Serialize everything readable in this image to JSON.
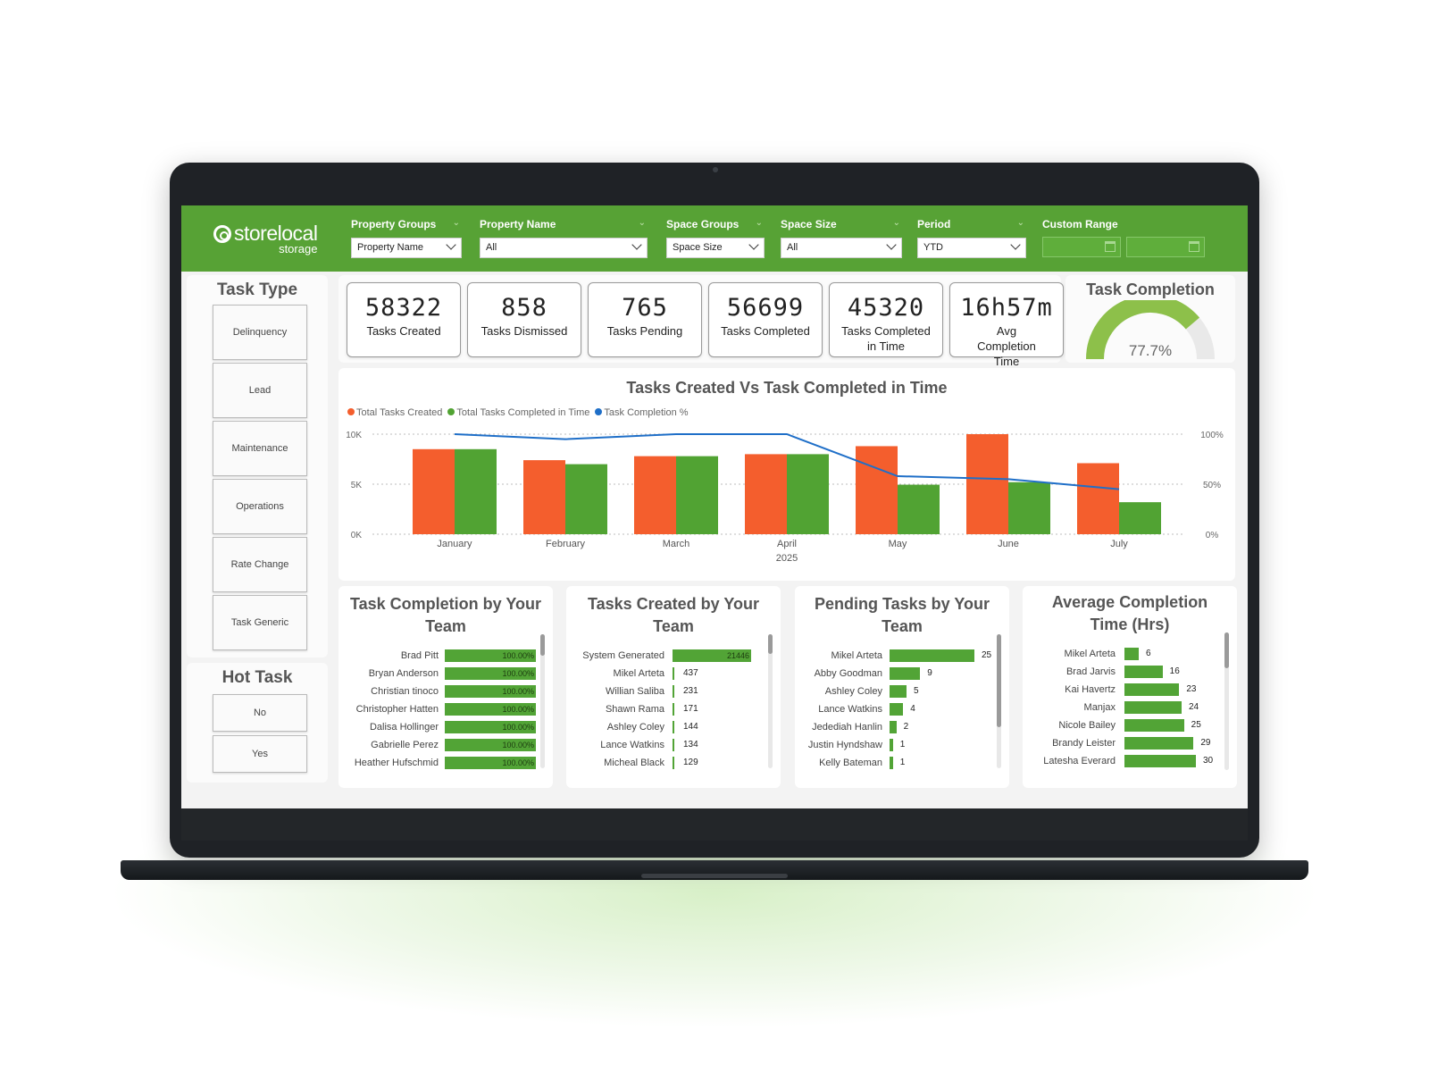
{
  "header": {
    "logo_main": "storelocal",
    "logo_sub": "storage",
    "filters": [
      {
        "label": "Property Groups",
        "value": "Property Name"
      },
      {
        "label": "Property Name",
        "value": "All"
      },
      {
        "label": "Space Groups",
        "value": "Space Size"
      },
      {
        "label": "Space Size",
        "value": "All"
      },
      {
        "label": "Period",
        "value": "YTD"
      }
    ],
    "custom_range_label": "Custom Range"
  },
  "task_type": {
    "title": "Task Type",
    "items": [
      "Delinquency",
      "Lead",
      "Maintenance",
      "Operations",
      "Rate Change",
      "Task Generic"
    ]
  },
  "hot_task": {
    "title": "Hot Task",
    "items": [
      "No",
      "Yes"
    ]
  },
  "kpis": [
    {
      "value": "58322",
      "label": "Tasks Created"
    },
    {
      "value": "858",
      "label": "Tasks Dismissed"
    },
    {
      "value": "765",
      "label": "Tasks Pending"
    },
    {
      "value": "56699",
      "label": "Tasks Completed"
    },
    {
      "value": "45320",
      "label": "Tasks Completed in Time"
    },
    {
      "value": "16h57m",
      "label": "Avg Completion Time"
    }
  ],
  "gauge": {
    "title": "Task Completion",
    "value_label": "77.7%",
    "value": 0.777,
    "color": "#8dc04a"
  },
  "chart_data": {
    "type": "bar",
    "title": "Tasks Created Vs Task Completed in Time",
    "categories": [
      "January",
      "February",
      "March",
      "April",
      "May",
      "June",
      "July"
    ],
    "x_sublabel": "2025",
    "y_ticks": [
      "10K",
      "5K",
      "0K"
    ],
    "y2_ticks": [
      "100%",
      "50%",
      "0%"
    ],
    "ylim": [
      0,
      10000
    ],
    "y2lim": [
      0,
      100
    ],
    "series": [
      {
        "name": "Total Tasks Created",
        "color": "#f45e2d",
        "values": [
          8500,
          7400,
          7800,
          8000,
          8800,
          10000,
          7100
        ]
      },
      {
        "name": "Total Tasks Completed in Time",
        "color": "#51a333",
        "values": [
          8500,
          7000,
          7800,
          8000,
          4950,
          5200,
          3200
        ]
      },
      {
        "name": "Task Completion %",
        "color": "#1f6fc8",
        "type": "line",
        "values": [
          100,
          95,
          100,
          100,
          58,
          55,
          45
        ]
      }
    ]
  },
  "team_completion": {
    "title": "Task Completion by Your Team",
    "rows": [
      {
        "name": "Brad Pitt",
        "value": 100,
        "label": "100.00%"
      },
      {
        "name": "Bryan Anderson",
        "value": 100,
        "label": "100.00%"
      },
      {
        "name": "Christian tinoco",
        "value": 100,
        "label": "100.00%"
      },
      {
        "name": "Christopher Hatten",
        "value": 100,
        "label": "100.00%"
      },
      {
        "name": "Dalisa Hollinger",
        "value": 100,
        "label": "100.00%"
      },
      {
        "name": "Gabrielle Perez",
        "value": 100,
        "label": "100.00%"
      },
      {
        "name": "Heather Hufschmid",
        "value": 100,
        "label": "100.00%"
      }
    ]
  },
  "team_created": {
    "title": "Tasks Created by Your Team",
    "rows": [
      {
        "name": "System Generated",
        "value": 21446,
        "label": "21446"
      },
      {
        "name": "Mikel Arteta",
        "value": 437,
        "label": "437"
      },
      {
        "name": "Willian Saliba",
        "value": 231,
        "label": "231"
      },
      {
        "name": "Shawn Rama",
        "value": 171,
        "label": "171"
      },
      {
        "name": "Ashley Coley",
        "value": 144,
        "label": "144"
      },
      {
        "name": "Lance Watkins",
        "value": 134,
        "label": "134"
      },
      {
        "name": "Micheal Black",
        "value": 129,
        "label": "129"
      }
    ]
  },
  "team_pending": {
    "title": "Pending Tasks by Your Team",
    "rows": [
      {
        "name": "Mikel Arteta",
        "value": 25,
        "label": "25"
      },
      {
        "name": "Abby Goodman",
        "value": 9,
        "label": "9"
      },
      {
        "name": "Ashley Coley",
        "value": 5,
        "label": "5"
      },
      {
        "name": "Lance Watkins",
        "value": 4,
        "label": "4"
      },
      {
        "name": "Jedediah Hanlin",
        "value": 2,
        "label": "2"
      },
      {
        "name": "Justin Hyndshaw",
        "value": 1,
        "label": "1"
      },
      {
        "name": "Kelly Bateman",
        "value": 1,
        "label": "1"
      }
    ]
  },
  "team_avg_time": {
    "title": "Average Completion Time (Hrs)",
    "rows": [
      {
        "name": "Mikel Arteta",
        "value": 6,
        "label": "6"
      },
      {
        "name": "Brad Jarvis",
        "value": 16,
        "label": "16"
      },
      {
        "name": "Kai Havertz",
        "value": 23,
        "label": "23"
      },
      {
        "name": "Manjax",
        "value": 24,
        "label": "24"
      },
      {
        "name": "Nicole Bailey",
        "value": 25,
        "label": "25"
      },
      {
        "name": "Brandy Leister",
        "value": 29,
        "label": "29"
      },
      {
        "name": "Latesha Everard",
        "value": 30,
        "label": "30"
      }
    ]
  }
}
